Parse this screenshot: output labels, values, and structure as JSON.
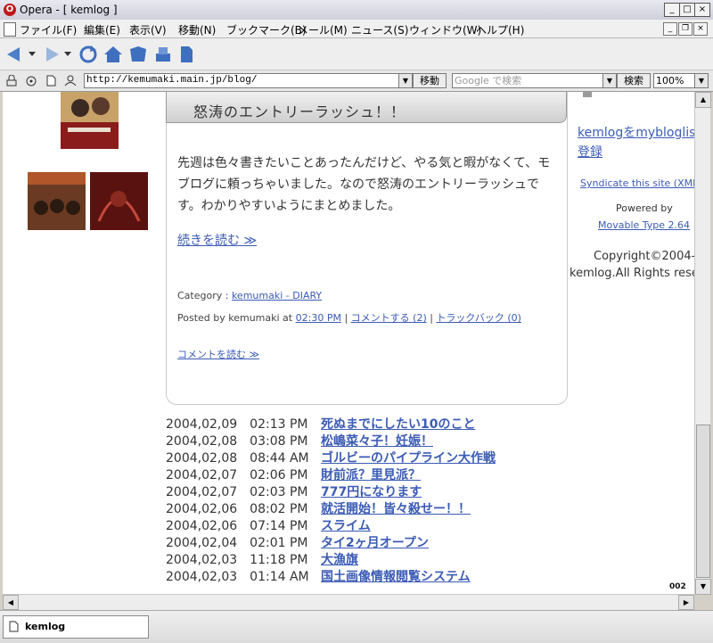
{
  "window": {
    "title": "Opera - [ kemlog ]",
    "controls": [
      "_",
      "□",
      "×"
    ]
  },
  "menu": [
    {
      "label": "ファイル(F)"
    },
    {
      "label": "編集(E)"
    },
    {
      "label": "表示(V)"
    },
    {
      "label": "移動(N)"
    },
    {
      "label": "ブックマーク(B)"
    },
    {
      "label": "メール(M)"
    },
    {
      "label": "ニュース(S)"
    },
    {
      "label": "ウィンドウ(W)"
    },
    {
      "label": "ヘルプ(H)"
    }
  ],
  "address": {
    "url": "http://kemumaki.main.jp/blog/",
    "go_label": "移動",
    "search_placeholder": "Google で検索",
    "search_button": "検索",
    "zoom": "100%"
  },
  "entry": {
    "title": "怒涛のエントリーラッシュ！！",
    "body": "先週は色々書きたいことあったんだけど、やる気と暇がなくて、モブログに頼っちゃいました。なので怒涛のエントリーラッシュです。わかりやすいようにまとめました。",
    "read_more": "続きを読む ≫",
    "category_label": "Category : ",
    "category_link": "kemumaki - DIARY",
    "posted_by": "Posted by kemumaki at ",
    "time_link": "02:30 PM",
    "separator": " | ",
    "comment_link": "コメントする (2)",
    "trackback_link": "トラックバック (0)",
    "read_comments": "コメントを読む ≫"
  },
  "recent_entries": [
    {
      "date": "2004,02,09　02:13 PM",
      "title": "死ぬまでにしたい10のこと"
    },
    {
      "date": "2004,02,08　03:08 PM",
      "title": "松嶋菜々子！妊娠！"
    },
    {
      "date": "2004,02,08　08:44 AM",
      "title": "ゴルビーのパイプライン大作戦"
    },
    {
      "date": "2004,02,07　02:06 PM",
      "title": "財前派？里見派？"
    },
    {
      "date": "2004,02,07　02:03 PM",
      "title": "777円になります"
    },
    {
      "date": "2004,02,06　08:02 PM",
      "title": "就活開始！皆々殺せー！！"
    },
    {
      "date": "2004,02,06　07:14 PM",
      "title": "スライム"
    },
    {
      "date": "2004,02,04　02:01 PM",
      "title": "タイ2ヶ月オープン"
    },
    {
      "date": "2004,02,03　11:18 PM",
      "title": "大漁旗"
    },
    {
      "date": "2004,02,03　01:14 AM",
      "title": "国土画像情報閲覧システム"
    }
  ],
  "sidebar": {
    "bloglist_link_1": "kemlogをmybloglistに",
    "bloglist_link_2": "登録",
    "syndicate": "Syndicate this site (XML)",
    "powered_by": "Powered by",
    "mt_link": "Movable Type 2.64",
    "copyright_1": "Copyright©2004-",
    "copyright_2": "kemlog.All Rights reserved."
  },
  "counter": "002",
  "tab": {
    "label": "kemlog"
  }
}
